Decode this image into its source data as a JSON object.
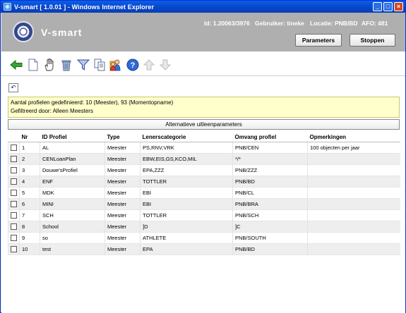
{
  "window": {
    "title": "V-smart [ 1.0.01 ] - Windows Internet Explorer",
    "btn_min": "_",
    "btn_max": "□",
    "btn_close": "×"
  },
  "header": {
    "brand": "V-smart",
    "id_text": "Id: 1.20063/3976",
    "user_text": "Gebruiker: tineke",
    "location_text": "Locatie: PNB/BD",
    "afo_text": "AFO: 481",
    "parameters_label": "Parameters",
    "stop_label": "Stoppen"
  },
  "toolbar": {
    "icons": [
      "back-arrow-icon",
      "new-document-icon",
      "hand-select-icon",
      "delete-bin-icon",
      "filter-funnel-icon",
      "copy-icon",
      "users-icon",
      "help-icon",
      "arrow-up-icon",
      "arrow-down-icon"
    ],
    "undo_symbol": "↶"
  },
  "info": {
    "line1": "Aantal profielen gedefinieerd: 10 (Meester), 93 (Momentopname)",
    "line2": "Gefiltreerd door: Alleen Meesters"
  },
  "alt_button_label": "Alternatieve uitleenparameters",
  "table": {
    "headers": [
      "Nr",
      "ID Profiel",
      "Type",
      "Lenerscategorie",
      "Omvang profiel",
      "Opmerkingen"
    ],
    "rows": [
      [
        "1",
        "AL",
        "Meester",
        "PS,RNV,VRK",
        "PNB/CEN",
        "100 objecten per jaar"
      ],
      [
        "2",
        "CENLoanPlan",
        "Meester",
        "EBW,EIS,GS,KCO,MIL",
        "*/*",
        ""
      ],
      [
        "3",
        "Douwe'sProfiel",
        "Meester",
        "EPA,ZZZ",
        "PNB/ZZZ",
        ""
      ],
      [
        "4",
        "ENF",
        "Meester",
        "TOTTLER",
        "PNB/BD",
        ""
      ],
      [
        "5",
        "MDK",
        "Meester",
        "EBI",
        "PNB/CL",
        ""
      ],
      [
        "6",
        "MINI",
        "Meester",
        "EBI",
        "PNB/BRA",
        ""
      ],
      [
        "7",
        "SCH",
        "Meester",
        "TOTTLER",
        "PNB/SCH",
        ""
      ],
      [
        "8",
        "School",
        "Meester",
        "]D",
        "]C",
        ""
      ],
      [
        "9",
        "so",
        "Meester",
        "ATHLETE",
        "PNB/SOUTH",
        ""
      ],
      [
        "10",
        "test",
        "Meester",
        "EPA",
        "PNB/BD",
        ""
      ]
    ]
  }
}
